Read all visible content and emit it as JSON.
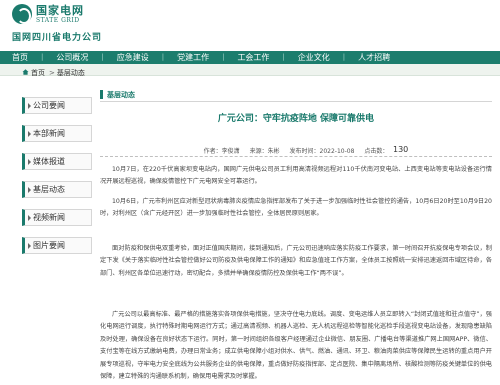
{
  "header": {
    "logo_cn": "国家电网",
    "logo_en": "STATE GRID",
    "company": "国网四川省电力公司"
  },
  "nav": {
    "items": [
      "首页",
      "公司概况",
      "应急建设",
      "党建工作",
      "工会工作",
      "企业文化",
      "人才招聘"
    ]
  },
  "breadcrumb": {
    "items": [
      "首页",
      "基层动态"
    ]
  },
  "sidebar": {
    "items": [
      "公司要闻",
      "本部新闻",
      "媒体报道",
      "基层动态",
      "视频新闻",
      "图片要闻"
    ]
  },
  "section": {
    "title": "基层动态"
  },
  "article": {
    "title": "广元公司：守牢抗疫阵地 保障可靠供电",
    "author": "作者：李俊潇",
    "source": "来源：朱彬",
    "date": "发布时间：2022-10-08",
    "views_label": "点击数：",
    "views": "130",
    "paragraphs": [
      "10月7日，在220千伏高家坝变电站内，国网广元供电公司员工利用高清视频远程对110千伏南河变电站、上西变电站等变电站设备运行情况开展远程巡视，确保疫情管控下广元电网安全可靠运行。",
      "10月6日，广元市利州区应对新型冠状病毒肺炎疫情应急指挥部发布了关于进一步加强临时性社会管控的通告，10月6日20时至10月9日20时，对利州区（含广元经开区）进一步加强临时性社会管控，全体居民原则居家。",
      "面对防疫和保供电双重考验，面对正值国庆期间，接到通知后，广元公司迅速响应落实防疫工作要求，第一时间召开抗疫保电专项会议，制定下发《关于落实临时性社会管控做好公司防疫及供电保障工作的通知》和应急值班工作方案，全体员工按照统一安排迅速返回市域区待命，各部门、利州区各单位迅速行动，密切配合，多措并举确保疫情防控及保供电工作“两不误”。",
      "广元公司以最高标准、最严格的措施落实各项保供电措施，坚决守住电力底线。调度、变电运维人员立即转入“封闭式值班和驻点值守”，强化电网运行调度，执行特殊时期电网运行方式；通过高清视频、机器人巡检、无人机远程巡检等智能化巡检手段巡视变电站设备，发现隐患缺陷及时处理，确保设备在良好状态下运行。同时，第一时间组织各级客户经理通过企业微信、朋友圈、广播电台等渠道推广网上国网APP、微信、支付宝等在线方式缴纳电费，办理日常业务；成立供电保障小组对供水、供气、燃油、通讯、环卫、粮油肉菜供应等保障民生运转的重点用户开展专项巡视，守牢电力安全底线为公共服务企业的供电保障，重点做好防疫指挥部、定点医院、集中隔离场所、核酸检测等防疫关键单位的供电保障，建立特殊的沟通联系机制，确保用电需求及时掌握。"
    ]
  },
  "colors": {
    "brand": "#1a7a6c",
    "nav_bg": "#1c7d6d"
  }
}
